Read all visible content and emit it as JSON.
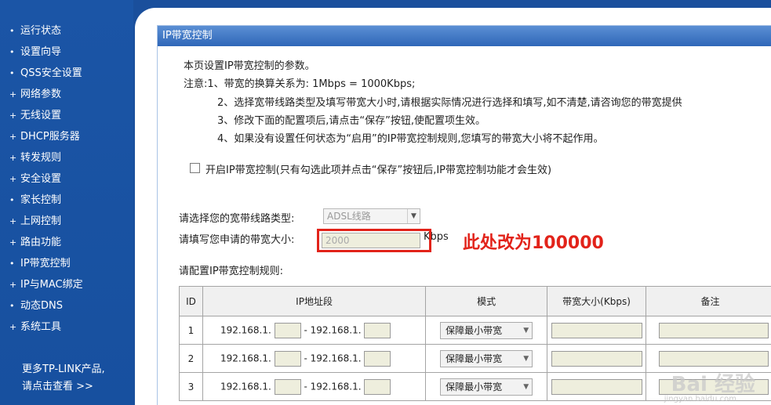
{
  "sidebar": {
    "items": [
      {
        "label": "运行状态"
      },
      {
        "label": "设置向导"
      },
      {
        "label": "QSS安全设置"
      },
      {
        "label": "网络参数"
      },
      {
        "label": "无线设置"
      },
      {
        "label": "DHCP服务器"
      },
      {
        "label": "转发规则"
      },
      {
        "label": "安全设置"
      },
      {
        "label": "家长控制"
      },
      {
        "label": "上网控制"
      },
      {
        "label": "路由功能"
      },
      {
        "label": "IP带宽控制"
      },
      {
        "label": "IP与MAC绑定"
      },
      {
        "label": "动态DNS"
      },
      {
        "label": "系统工具"
      }
    ],
    "more_line1": "更多TP-LINK产品,",
    "more_line2": "请点击查看 >>"
  },
  "panel": {
    "title": "IP带宽控制",
    "intro": "本页设置IP带宽控制的参数。",
    "notes": [
      "注意:1、带宽的换算关系为: 1Mbps = 1000Kbps;",
      "2、选择宽带线路类型及填写带宽大小时,请根据实际情况进行选择和填写,如不清楚,请咨询您的带宽提供",
      "3、修改下面的配置项后,请点击“保存”按钮,使配置项生效。",
      "4、如果没有设置任何状态为“启用”的IP带宽控制规则,您填写的带宽大小将不起作用。"
    ],
    "enable_label": "开启IP带宽控制(只有勾选此项并点击“保存”按钮后,IP带宽控制功能才会生效)",
    "line_type_label": "请选择您的宽带线路类型:",
    "line_type_value": "ADSL线路",
    "bandwidth_label": "请填写您申请的带宽大小:",
    "bandwidth_value": "2000",
    "bandwidth_unit": "Kbps",
    "rules_label": "请配置IP带宽控制规则:"
  },
  "annotation": "此处改为100000",
  "table": {
    "headers": [
      "ID",
      "IP地址段",
      "模式",
      "带宽大小(Kbps)",
      "备注"
    ],
    "rows": [
      {
        "id": "1",
        "ip_prefix_start": "192.168.1.",
        "dash": "-",
        "ip_prefix_end": "192.168.1.",
        "mode": "保障最小带宽"
      },
      {
        "id": "2",
        "ip_prefix_start": "192.168.1.",
        "dash": "-",
        "ip_prefix_end": "192.168.1.",
        "mode": "保障最小带宽"
      },
      {
        "id": "3",
        "ip_prefix_start": "192.168.1.",
        "dash": "-",
        "ip_prefix_end": "192.168.1.",
        "mode": "保障最小带宽"
      }
    ]
  },
  "watermark": {
    "main": "Bai 经验",
    "sub": "jingyan.baidu.com"
  },
  "colors": {
    "sidebar": "#1a4f9c",
    "annotation": "#e2231a",
    "title_bar": "#3a72c2"
  }
}
